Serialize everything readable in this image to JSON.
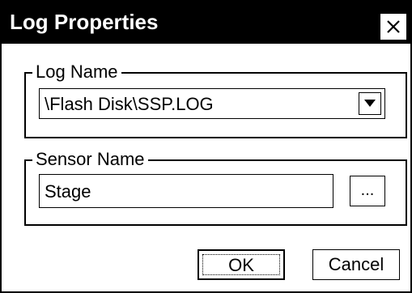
{
  "dialog": {
    "title": "Log Properties",
    "close_label": "×"
  },
  "log_group": {
    "label": "Log Name",
    "selected_value": "\\Flash Disk\\SSP.LOG"
  },
  "sensor_group": {
    "label": "Sensor Name",
    "value": "Stage",
    "browse_label": "..."
  },
  "buttons": {
    "ok_label": "OK",
    "cancel_label": "Cancel"
  }
}
